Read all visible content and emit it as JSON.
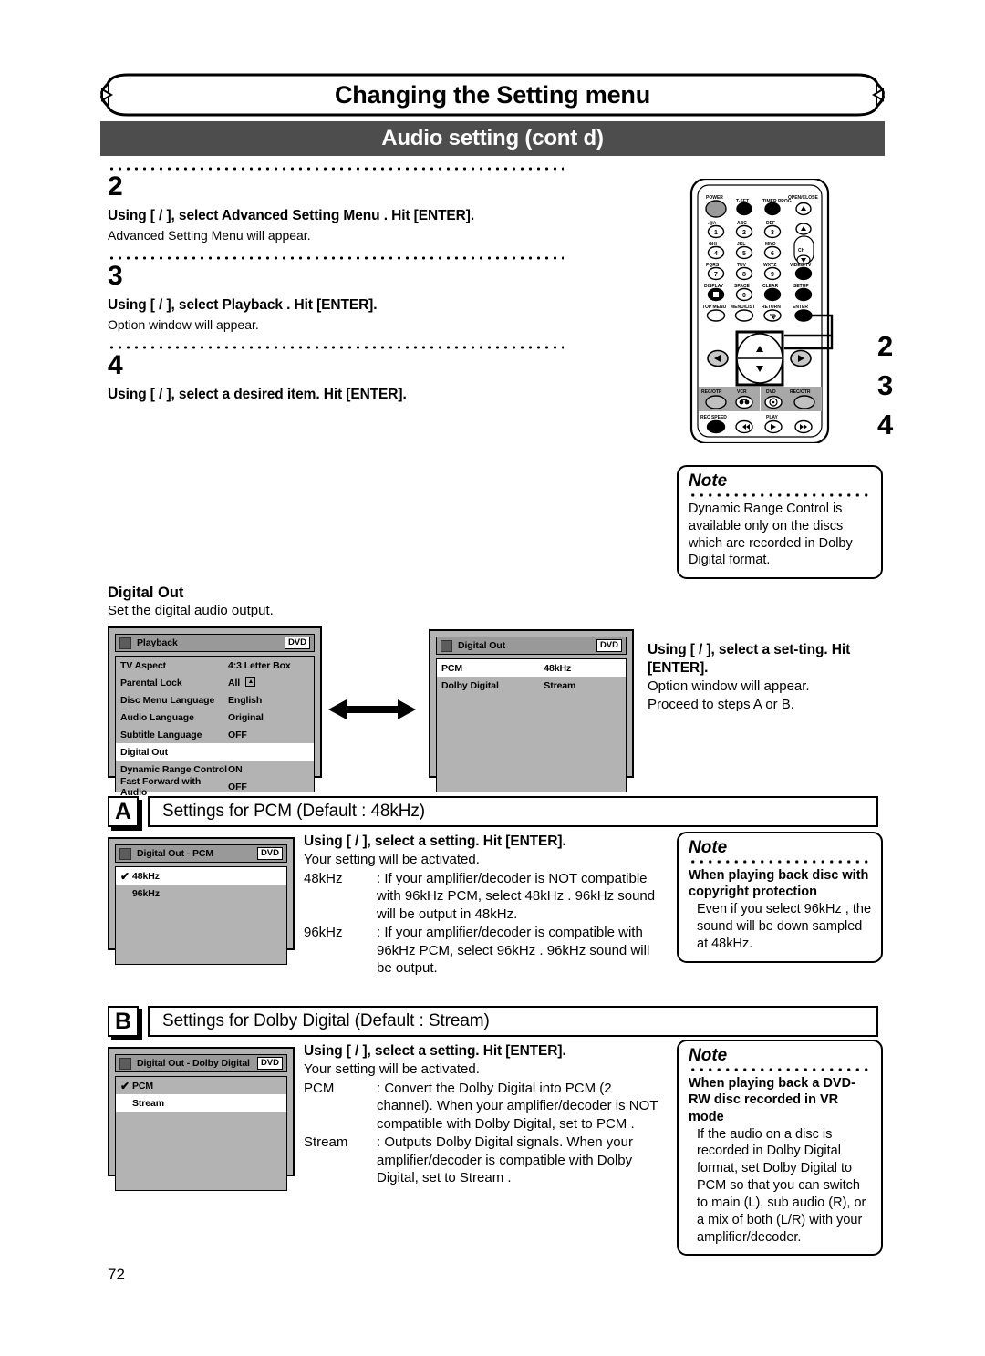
{
  "header": {
    "title": "Changing the Setting menu",
    "subtitle": "Audio setting (cont d)"
  },
  "steps": [
    {
      "number": "2",
      "bold": "Using [ / ], select  Advanced Setting Menu . Hit [ENTER].",
      "sub": "Advanced Setting Menu will appear."
    },
    {
      "number": "3",
      "bold": "Using [ / ], select  Playback . Hit [ENTER].",
      "sub": "Option window will appear."
    },
    {
      "number": "4",
      "bold": "Using [ / ], select a desired item. Hit [ENTER].",
      "sub": ""
    }
  ],
  "remote": {
    "callouts": [
      "2",
      "3",
      "4"
    ],
    "buttons": {
      "power": "POWER",
      "tset": "T-SET",
      "timer_prog": "TIMER PROG.",
      "open_close": "OPEN/CLOSE",
      "key1_label": ".@/:",
      "key1": "1",
      "key2_label": "ABC",
      "key2": "2",
      "key3_label": "DEF",
      "key3": "3",
      "key4_label": "GHI",
      "key4": "4",
      "key5_label": "JKL",
      "key5": "5",
      "key6_label": "MNO",
      "key6": "6",
      "key7_label": "PQRS",
      "key7": "7",
      "key8_label": "TUV",
      "key8": "8",
      "key9_label": "WXYZ",
      "key9": "9",
      "key0_label": "SPACE",
      "key0": "0",
      "ch": "CH",
      "video_tv": "VIDEO/TV",
      "display": "DISPLAY",
      "clear": "CLEAR",
      "setup": "SETUP",
      "top_menu": "TOP MENU",
      "menu_list": "MENU/LIST",
      "return": "RETURN",
      "enter": "ENTER",
      "rec_otr_left": "REC/OTR",
      "vcr": "VCR",
      "dvd": "DVD",
      "rec_otr_right": "REC/OTR",
      "rec_speed": "REC SPEED",
      "play": "PLAY"
    }
  },
  "notes": {
    "label": "Note",
    "note1": {
      "body": "Dynamic Range Control is available only on the discs which are recorded in Dolby Digital format."
    },
    "note2": {
      "head": "When playing back disc with copyright protection",
      "body": "Even if you select  96kHz , the sound will be down sampled at 48kHz."
    },
    "note3": {
      "head": "When playing back a DVD-RW disc recorded in VR mode",
      "body": "If the audio on a disc is recorded in Dolby Digital format, set  Dolby Digital  to  PCM  so that you can switch to main (L), sub audio (R), or a mix of both (L/R) with your amplifier/decoder."
    }
  },
  "digital_out": {
    "title": "Digital Out",
    "subtitle": "Set the digital audio output."
  },
  "osd_playback": {
    "title": "Playback",
    "badge": "DVD",
    "rows": [
      {
        "label": "TV Aspect",
        "value": "4:3 Letter Box",
        "selected": false,
        "lock": false
      },
      {
        "label": "Parental Lock",
        "value": "All",
        "selected": false,
        "lock": true
      },
      {
        "label": "Disc Menu Language",
        "value": "English",
        "selected": false,
        "lock": false
      },
      {
        "label": "Audio Language",
        "value": "Original",
        "selected": false,
        "lock": false
      },
      {
        "label": "Subtitle Language",
        "value": "OFF",
        "selected": false,
        "lock": false
      },
      {
        "label": "Digital Out",
        "value": "",
        "selected": true,
        "lock": false
      },
      {
        "label": "Dynamic Range Control",
        "value": "ON",
        "selected": false,
        "lock": false
      },
      {
        "label": "Fast Forward with Audio",
        "value": "OFF",
        "selected": false,
        "lock": false
      }
    ]
  },
  "osd_digitalout": {
    "title": "Digital Out",
    "badge": "DVD",
    "rows": [
      {
        "label": "PCM",
        "value": "48kHz",
        "selected": true
      },
      {
        "label": "Dolby Digital",
        "value": "Stream",
        "selected": false
      }
    ]
  },
  "instr_top": {
    "bold": "Using [ / ], select a set-ting. Hit [ENTER].",
    "line1": "Option window will appear.",
    "line2": "Proceed to steps A or B."
  },
  "section_a": {
    "letter": "A",
    "title": "Settings for PCM (Default : 48kHz)",
    "osd": {
      "title": "Digital Out - PCM",
      "badge": "DVD",
      "rows": [
        {
          "label": "48kHz",
          "checked": true,
          "selected": true
        },
        {
          "label": "96kHz",
          "checked": false,
          "selected": false
        }
      ]
    },
    "instr": {
      "bold": "Using [ / ], select a setting. Hit [ENTER].",
      "line1": "Your setting will be activated.",
      "defs": [
        {
          "term": "48kHz",
          "desc": ": If your amplifier/decoder is NOT compatible with 96kHz PCM, select  48kHz . 96kHz sound will be output in 48kHz."
        },
        {
          "term": "96kHz",
          "desc": ": If your amplifier/decoder is compatible with 96kHz PCM, select  96kHz . 96kHz sound will be output."
        }
      ]
    }
  },
  "section_b": {
    "letter": "B",
    "title": "Settings for Dolby Digital (Default : Stream)",
    "osd": {
      "title": "Digital Out - Dolby Digital",
      "badge": "DVD",
      "rows": [
        {
          "label": "PCM",
          "checked": true,
          "selected": false
        },
        {
          "label": "Stream",
          "checked": false,
          "selected": true
        }
      ]
    },
    "instr": {
      "bold": "Using [ / ], select a setting. Hit [ENTER].",
      "line1": "Your setting will be activated.",
      "defs": [
        {
          "term": "PCM",
          "desc": ": Convert the Dolby Digital into PCM (2 channel). When your amplifier/decoder is NOT compatible with Dolby Digital, set to  PCM ."
        },
        {
          "term": "Stream",
          "desc": ": Outputs Dolby Digital signals. When your amplifier/decoder is compatible with Dolby Digital, set to  Stream ."
        }
      ]
    }
  },
  "page_number": "72"
}
